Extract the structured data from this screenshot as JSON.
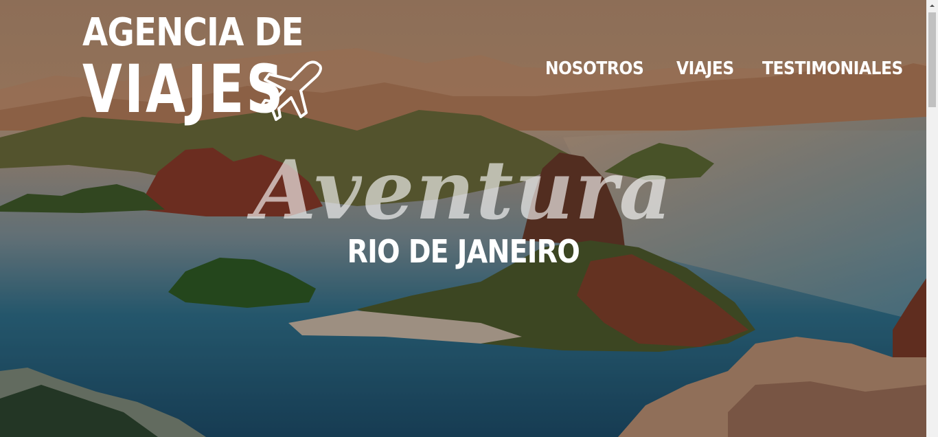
{
  "brand": {
    "line1": "AGENCIA DE",
    "line2": "VIAJES"
  },
  "nav": {
    "items": [
      "NOSOTROS",
      "VIAJES",
      "TESTIMONIALES"
    ]
  },
  "hero": {
    "script_text": "Aventura",
    "destination": "RIO DE JANEIRO"
  },
  "icons": {
    "logo_icon": "airplane-icon"
  },
  "colors": {
    "text": "#ffffff",
    "scrollbar_track": "#f1f1f1",
    "scrollbar_thumb": "#c1c1c1"
  }
}
